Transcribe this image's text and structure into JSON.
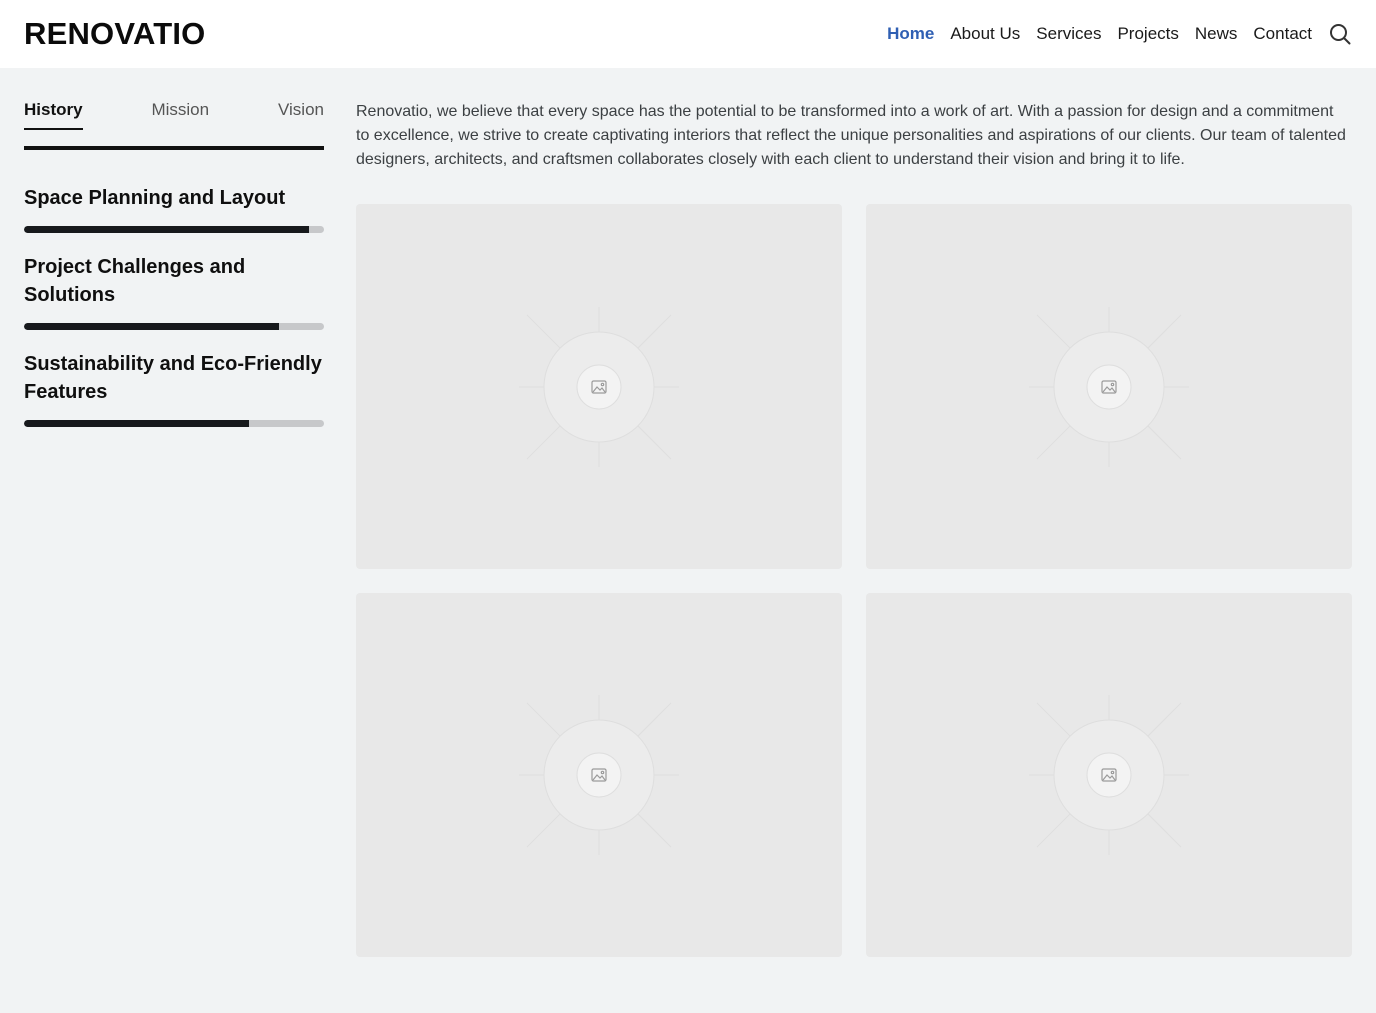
{
  "brand": {
    "name": "RENOVATIO"
  },
  "nav": {
    "items": [
      "Home",
      "About Us",
      "Services",
      "Projects",
      "News",
      "Contact"
    ],
    "active": "Home",
    "active_color": "#2f5fb3",
    "search_icon": "search-icon"
  },
  "sidebar": {
    "tabs": [
      "History",
      "Mission",
      "Vision"
    ],
    "active_tab": "History",
    "topics": [
      {
        "title": "Space Planning and Layout",
        "progress": 0.95
      },
      {
        "title": "Project Challenges and Solutions",
        "progress": 0.85
      },
      {
        "title": "Sustainability and Eco-Friendly Features",
        "progress": 0.75
      }
    ]
  },
  "main": {
    "intro": "Renovatio, we believe that every space has the potential to be transformed into a work of art. With a passion for design and a commitment to excellence, we strive to create captivating interiors that reflect the unique personalities and aspirations of our clients. Our team of talented designers, architects, and craftsmen collaborates closely with each client to understand their vision and bring it to life.",
    "images": [
      "image-placeholder-icon",
      "image-placeholder-icon",
      "image-placeholder-icon",
      "image-placeholder-icon"
    ]
  }
}
